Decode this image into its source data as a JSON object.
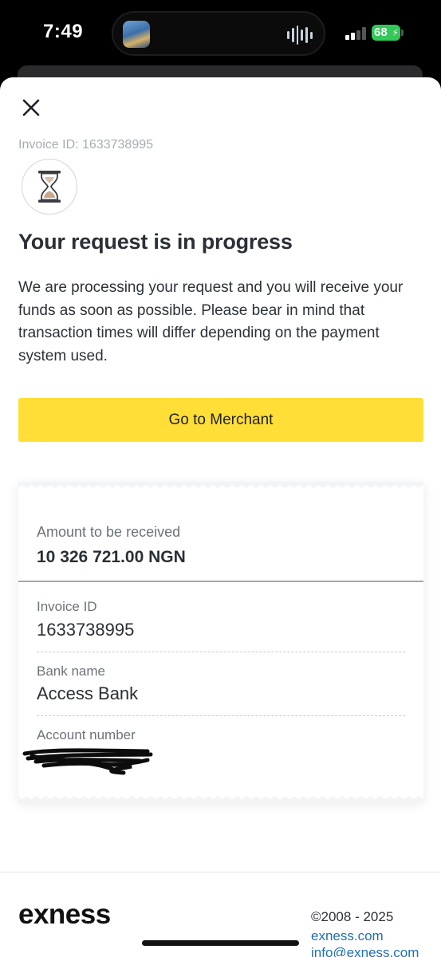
{
  "status_bar": {
    "time": "7:49",
    "battery": "68",
    "accent_battery": "#34c759"
  },
  "sheet": {
    "invoice_top": "Invoice ID: 1633738995",
    "status_icon": "hourglass-icon",
    "title": "Your request is in progress",
    "description": "We are processing your request and you will receive your funds as soon as possible. Please bear in mind that transaction times will differ depending on the payment system used.",
    "button_label": "Go to Merchant",
    "button_color": "#ffde38"
  },
  "receipt": {
    "amount_label": "Amount to be received",
    "amount_value": "10 326 721.00 NGN",
    "fields": [
      {
        "label": "Invoice ID",
        "value": "1633738995"
      },
      {
        "label": "Bank name",
        "value": "Access Bank"
      },
      {
        "label": "Account number",
        "value": ""
      }
    ]
  },
  "footer": {
    "logo": "exness",
    "copyright": "©2008 - 2025",
    "links": [
      "exness.com",
      "info@exness.com"
    ],
    "link_color": "#1f6fb2"
  }
}
